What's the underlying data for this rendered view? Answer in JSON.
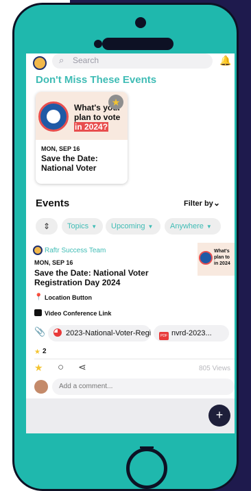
{
  "search": {
    "placeholder": "Search"
  },
  "featured": {
    "heading": "Don't Miss These Events",
    "card": {
      "headline_1": "What's your",
      "headline_2": "plan to vote",
      "headline_3": "in 2024?",
      "date": "MON, SEP 16",
      "title": "Save the Date: National Voter"
    }
  },
  "events": {
    "heading": "Events",
    "filter_label": "Filter by",
    "chips": {
      "topics": "Topics",
      "upcoming": "Upcoming",
      "anywhere": "Anywhere"
    },
    "item": {
      "organizer": "Raftr Success Team",
      "date": "MON, SEP 16",
      "title": "Save the Date: National Voter Registration Day 2024",
      "location": "Location Button",
      "video": "Video Conference Link",
      "thumb_text": "What's plan to in 2024",
      "attachments": [
        "2023-National-Voter-Regi...",
        "nvrd-2023..."
      ],
      "reaction_count": "2",
      "views": "805 Views"
    }
  },
  "comment": {
    "placeholder": "Add a comment..."
  },
  "fab": {
    "label": "+"
  },
  "colors": {
    "teal": "#1fb8ad",
    "navy": "#1e1a4d",
    "accent": "#3fbcb5"
  }
}
